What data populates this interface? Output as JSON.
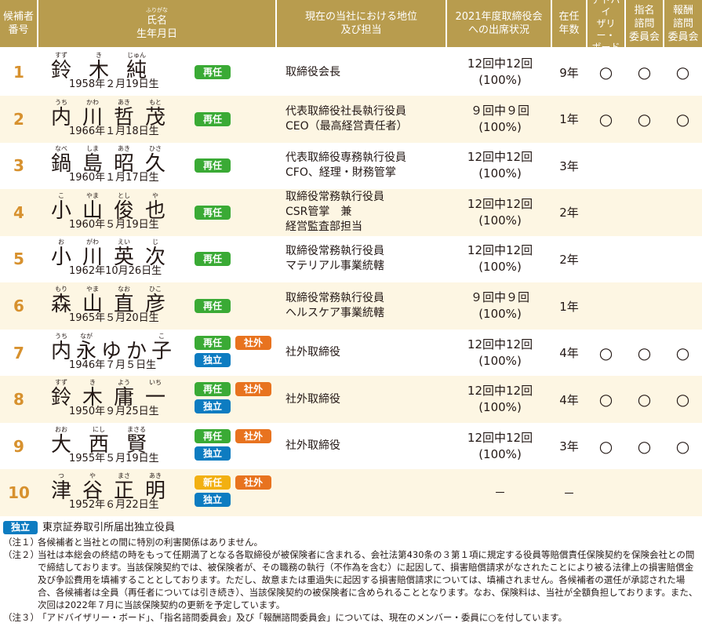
{
  "header": {
    "col_no": [
      "候補者",
      "番号"
    ],
    "col_name_furigana": "ふりがな",
    "col_name": "氏名",
    "col_birth": "生年月日",
    "col_position": [
      "現在の当社における地位",
      "及び担当"
    ],
    "col_attendance": [
      "2021年度取締役会",
      "への出席状況"
    ],
    "col_tenure": [
      "在任",
      "年数"
    ],
    "col_advisory": [
      "アドバイ",
      "ザリー・",
      "ボード"
    ],
    "col_nomination": [
      "指名",
      "諮問",
      "委員会"
    ],
    "col_compensation": [
      "報酬",
      "諮問",
      "委員会"
    ]
  },
  "candidates": [
    {
      "no": "1",
      "name": [
        {
          "r": "すず",
          "k": "鈴"
        },
        {
          "r": "き",
          "k": "木"
        },
        {
          "r": "じゅん",
          "k": "純"
        }
      ],
      "birth": "1958年２月19日生",
      "badges": [
        "再任"
      ],
      "position": [
        "取締役会長"
      ],
      "attendance": [
        "12回中12回",
        "(100%)"
      ],
      "tenure": "9年",
      "advisory": "○",
      "nomination": "○",
      "compensation": "○"
    },
    {
      "no": "2",
      "name": [
        {
          "r": "うち",
          "k": "内"
        },
        {
          "r": "かわ",
          "k": "川"
        },
        {
          "r": "あき",
          "k": "哲"
        },
        {
          "r": "もと",
          "k": "茂"
        }
      ],
      "birth": "1966年１月18日生",
      "badges": [
        "再任"
      ],
      "position": [
        "代表取締役社長執行役員",
        "CEO（最高経営責任者）"
      ],
      "attendance": [
        "９回中９回",
        "(100%)"
      ],
      "tenure": "1年",
      "advisory": "○",
      "nomination": "○",
      "compensation": "○"
    },
    {
      "no": "3",
      "name": [
        {
          "r": "なべ",
          "k": "鍋"
        },
        {
          "r": "しま",
          "k": "島"
        },
        {
          "r": "あき",
          "k": "昭"
        },
        {
          "r": "ひさ",
          "k": "久"
        }
      ],
      "birth": "1960年１月17日生",
      "badges": [
        "再任"
      ],
      "position": [
        "代表取締役専務執行役員",
        "CFO、経理・財務管掌"
      ],
      "attendance": [
        "12回中12回",
        "(100%)"
      ],
      "tenure": "3年",
      "advisory": "",
      "nomination": "",
      "compensation": ""
    },
    {
      "no": "4",
      "name": [
        {
          "r": "こ",
          "k": "小"
        },
        {
          "r": "やま",
          "k": "山"
        },
        {
          "r": "とし",
          "k": "俊"
        },
        {
          "r": "や",
          "k": "也"
        }
      ],
      "birth": "1960年５月19日生",
      "badges": [
        "再任"
      ],
      "position": [
        "取締役常務執行役員",
        "CSR管掌　兼",
        "経営監査部担当"
      ],
      "attendance": [
        "12回中12回",
        "(100%)"
      ],
      "tenure": "2年",
      "advisory": "",
      "nomination": "",
      "compensation": ""
    },
    {
      "no": "5",
      "name": [
        {
          "r": "お",
          "k": "小"
        },
        {
          "r": "がわ",
          "k": "川"
        },
        {
          "r": "えい",
          "k": "英"
        },
        {
          "r": "じ",
          "k": "次"
        }
      ],
      "birth": "1962年10月26日生",
      "badges": [
        "再任"
      ],
      "position": [
        "取締役常務執行役員",
        "マテリアル事業統轄"
      ],
      "attendance": [
        "12回中12回",
        "(100%)"
      ],
      "tenure": "2年",
      "advisory": "",
      "nomination": "",
      "compensation": ""
    },
    {
      "no": "6",
      "name": [
        {
          "r": "もり",
          "k": "森"
        },
        {
          "r": "やま",
          "k": "山"
        },
        {
          "r": "なお",
          "k": "直"
        },
        {
          "r": "ひこ",
          "k": "彦"
        }
      ],
      "birth": "1965年５月20日生",
      "badges": [
        "再任"
      ],
      "position": [
        "取締役常務執行役員",
        "ヘルスケア事業統轄"
      ],
      "attendance": [
        "９回中９回",
        "(100%)"
      ],
      "tenure": "1年",
      "advisory": "",
      "nomination": "",
      "compensation": ""
    },
    {
      "no": "7",
      "name": [
        {
          "r": "うち",
          "k": "内"
        },
        {
          "r": "なが",
          "k": "永"
        },
        {
          "r": "",
          "k": "ゆ"
        },
        {
          "r": "",
          "k": "か"
        },
        {
          "r": "こ",
          "k": "子"
        }
      ],
      "birth": "1946年７月５日生",
      "badges": [
        "再任",
        "社外",
        "独立"
      ],
      "position": [
        "社外取締役"
      ],
      "attendance": [
        "12回中12回",
        "(100%)"
      ],
      "tenure": "4年",
      "advisory": "○",
      "nomination": "○",
      "compensation": "○"
    },
    {
      "no": "8",
      "name": [
        {
          "r": "すず",
          "k": "鈴"
        },
        {
          "r": "き",
          "k": "木"
        },
        {
          "r": "よう",
          "k": "庸"
        },
        {
          "r": "いち",
          "k": "一"
        }
      ],
      "birth": "1950年９月25日生",
      "badges": [
        "再任",
        "社外",
        "独立"
      ],
      "position": [
        "社外取締役"
      ],
      "attendance": [
        "12回中12回",
        "(100%)"
      ],
      "tenure": "4年",
      "advisory": "○",
      "nomination": "○",
      "compensation": "○"
    },
    {
      "no": "9",
      "name": [
        {
          "r": "おお",
          "k": "大"
        },
        {
          "r": "にし",
          "k": "西"
        },
        {
          "r": "まさる",
          "k": "賢"
        }
      ],
      "birth": "1955年５月19日生",
      "badges": [
        "再任",
        "社外",
        "独立"
      ],
      "position": [
        "社外取締役"
      ],
      "attendance": [
        "12回中12回",
        "(100%)"
      ],
      "tenure": "3年",
      "advisory": "○",
      "nomination": "○",
      "compensation": "○"
    },
    {
      "no": "10",
      "name": [
        {
          "r": "つ",
          "k": "津"
        },
        {
          "r": "や",
          "k": "谷"
        },
        {
          "r": "まさ",
          "k": "正"
        },
        {
          "r": "あき",
          "k": "明"
        }
      ],
      "birth": "1952年６月22日生",
      "badges": [
        "新任",
        "社外",
        "独立"
      ],
      "position": [],
      "attendance": [
        "－"
      ],
      "tenure": "－",
      "advisory": "",
      "nomination": "",
      "compensation": ""
    }
  ],
  "legend": {
    "badge": "独立",
    "text": "東京証券取引所届出独立役員"
  },
  "notes": [
    {
      "tag": "（注１）",
      "text": "各候補者と当社との間に特別の利害関係はありません。"
    },
    {
      "tag": "（注２）",
      "text": "当社は本総会の終結の時をもって任期満了となる各取締役が被保険者に含まれる、会社法第430条の３第１項に規定する役員等賠償責任保険契約を保険会社との間で締結しております。当該保険契約では、被保険者が、その職務の執行（不作為を含む）に起因して、損害賠償請求がなされたことにより被る法律上の損害賠償金及び争訟費用を填補することとしております。ただし、故意または重過失に起因する損害賠償請求については、填補されません。各候補者の選任が承認された場合、各候補者は全員（再任者については引き続き）、当該保険契約の被保険者に含められることとなります。なお、保険料は、当社が全額負担しております。また、次回は2022年７月に当該保険契約の更新を予定しています。"
    },
    {
      "tag": "（注３）",
      "text": "「アドバイザリー・ボード」、「指名諮問委員会」及び「報酬諮問委員会」については、現在のメンバー・委員に○を付しています。"
    }
  ],
  "colors": {
    "header": "#b89c4e",
    "number": "#d7912e",
    "reappoint": "#3aaa35",
    "outside": "#e8731f",
    "independent": "#0d7cc1",
    "new": "#f2b012"
  }
}
